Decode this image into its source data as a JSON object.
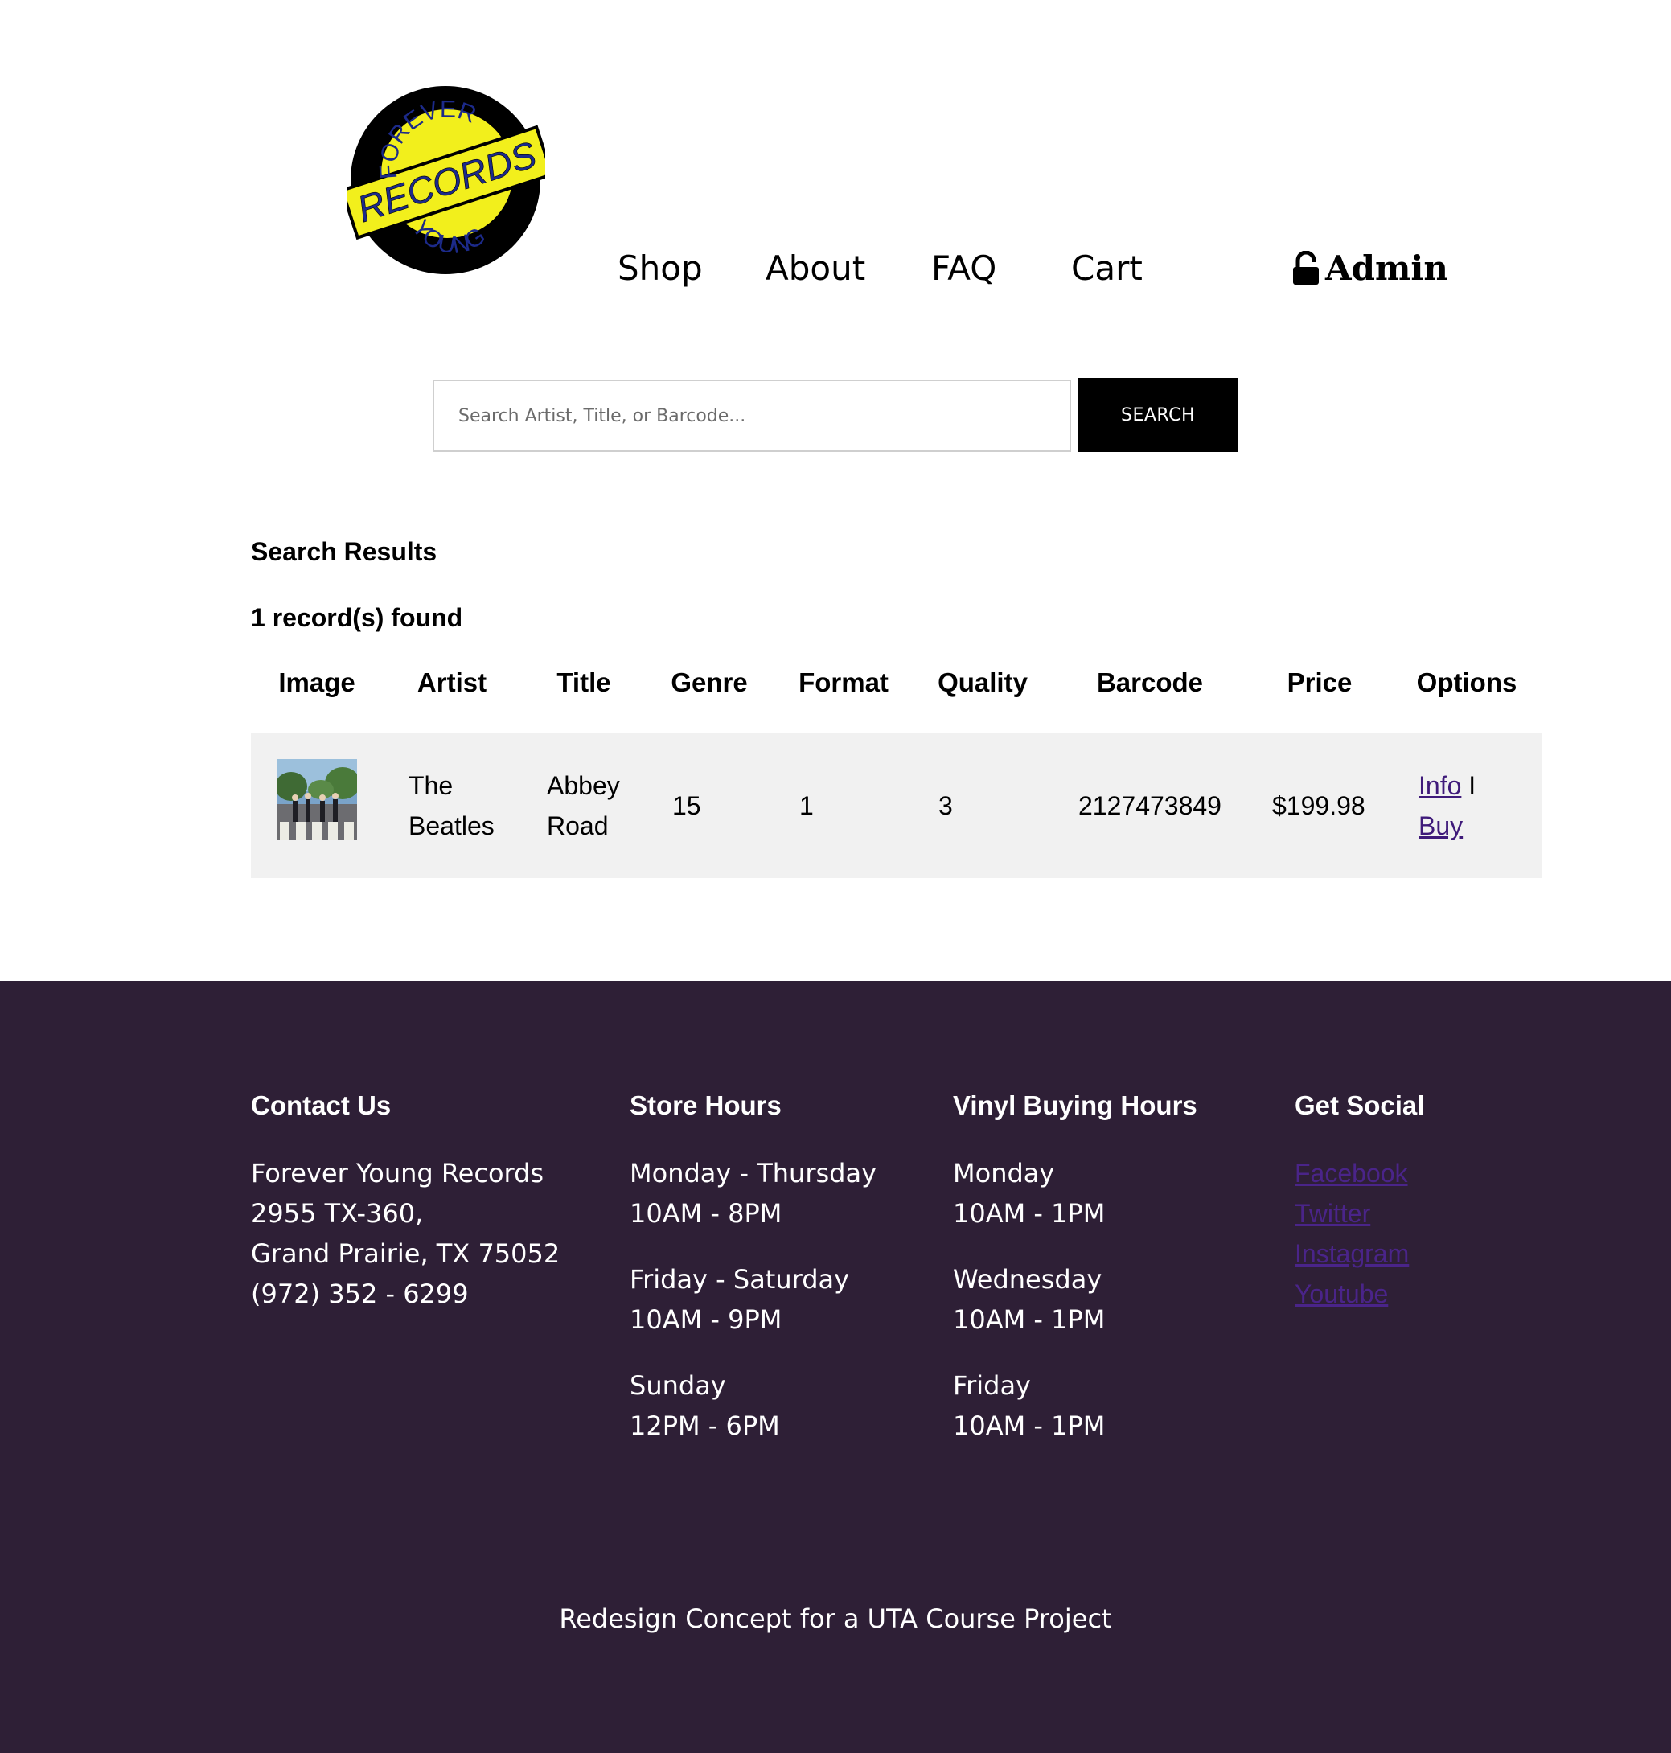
{
  "header": {
    "logo": {
      "top_text": "FOREVER",
      "band_text": "RECORDS",
      "bottom_text": "YOUNG",
      "colors": {
        "ring": "#000000",
        "disc": "#f2ef1c",
        "text": "#1c2a8a"
      }
    },
    "nav": {
      "shop": "Shop",
      "about": "About",
      "faq": "FAQ",
      "cart": "Cart",
      "admin": "Admin"
    }
  },
  "search": {
    "placeholder": "Search Artist, Title, or Barcode...",
    "value": "",
    "button_label": "SEARCH"
  },
  "results": {
    "title": "Search Results",
    "count_text": "1 record(s) found",
    "columns": [
      "Image",
      "Artist",
      "Title",
      "Genre",
      "Format",
      "Quality",
      "Barcode",
      "Price",
      "Options"
    ],
    "rows": [
      {
        "image_icon": "album-cover-abbey-road",
        "artist_line1": "The",
        "artist_line2": "Beatles",
        "title_line1": "Abbey",
        "title_line2": "Road",
        "genre": "15",
        "format": "1",
        "quality": "3",
        "barcode": "2127473849",
        "price": "$199.98",
        "info_label": "Info",
        "separator": "I",
        "buy_label": "Buy"
      }
    ]
  },
  "footer": {
    "background": "#2e1f36",
    "contact": {
      "heading": "Contact Us",
      "lines": [
        "Forever Young Records",
        "2955 TX-360,",
        "Grand Prairie, TX 75052",
        "(972) 352 - 6299"
      ]
    },
    "store_hours": {
      "heading": "Store Hours",
      "blocks": [
        {
          "days": "Monday - Thursday",
          "hours": "10AM - 8PM"
        },
        {
          "days": "Friday - Saturday",
          "hours": "10AM - 9PM"
        },
        {
          "days": "Sunday",
          "hours": "12PM - 6PM"
        }
      ]
    },
    "vinyl_hours": {
      "heading": "Vinyl Buying Hours",
      "blocks": [
        {
          "days": "Monday",
          "hours": "10AM - 1PM"
        },
        {
          "days": "Wednesday",
          "hours": "10AM - 1PM"
        },
        {
          "days": "Friday",
          "hours": "10AM - 1PM"
        }
      ]
    },
    "social": {
      "heading": "Get Social",
      "links": [
        "Facebook",
        "Twitter",
        "Instagram",
        "Youtube"
      ]
    },
    "credit": "Redesign Concept for a UTA Course Project"
  }
}
